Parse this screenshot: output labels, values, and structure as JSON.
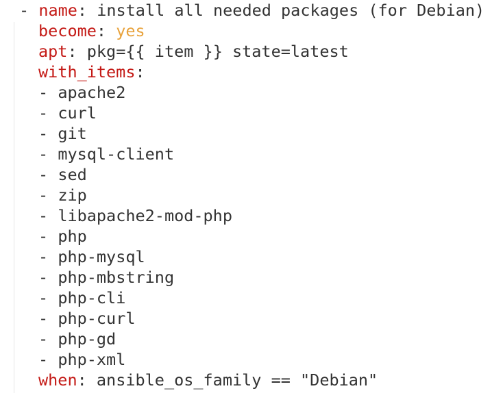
{
  "code": {
    "dash": "-",
    "name_key": "name",
    "colon": ":",
    "name_value": "install all needed packages (for Debian)",
    "become_key": "become",
    "become_value": "yes",
    "apt_key": "apt",
    "apt_value": "pkg={{ item }} state=latest",
    "with_items_key": "with_items",
    "items": [
      "apache2",
      "curl",
      "git",
      "mysql-client",
      "sed",
      "zip",
      "libapache2-mod-php",
      "php",
      "php-mysql",
      "php-mbstring",
      "php-cli",
      "php-curl",
      "php-gd",
      "php-xml"
    ],
    "when_key": "when",
    "when_value": "ansible_os_family == \"Debian\""
  },
  "colors": {
    "key": "#c41a16",
    "bool": "#e8a33d",
    "text": "#333333"
  }
}
